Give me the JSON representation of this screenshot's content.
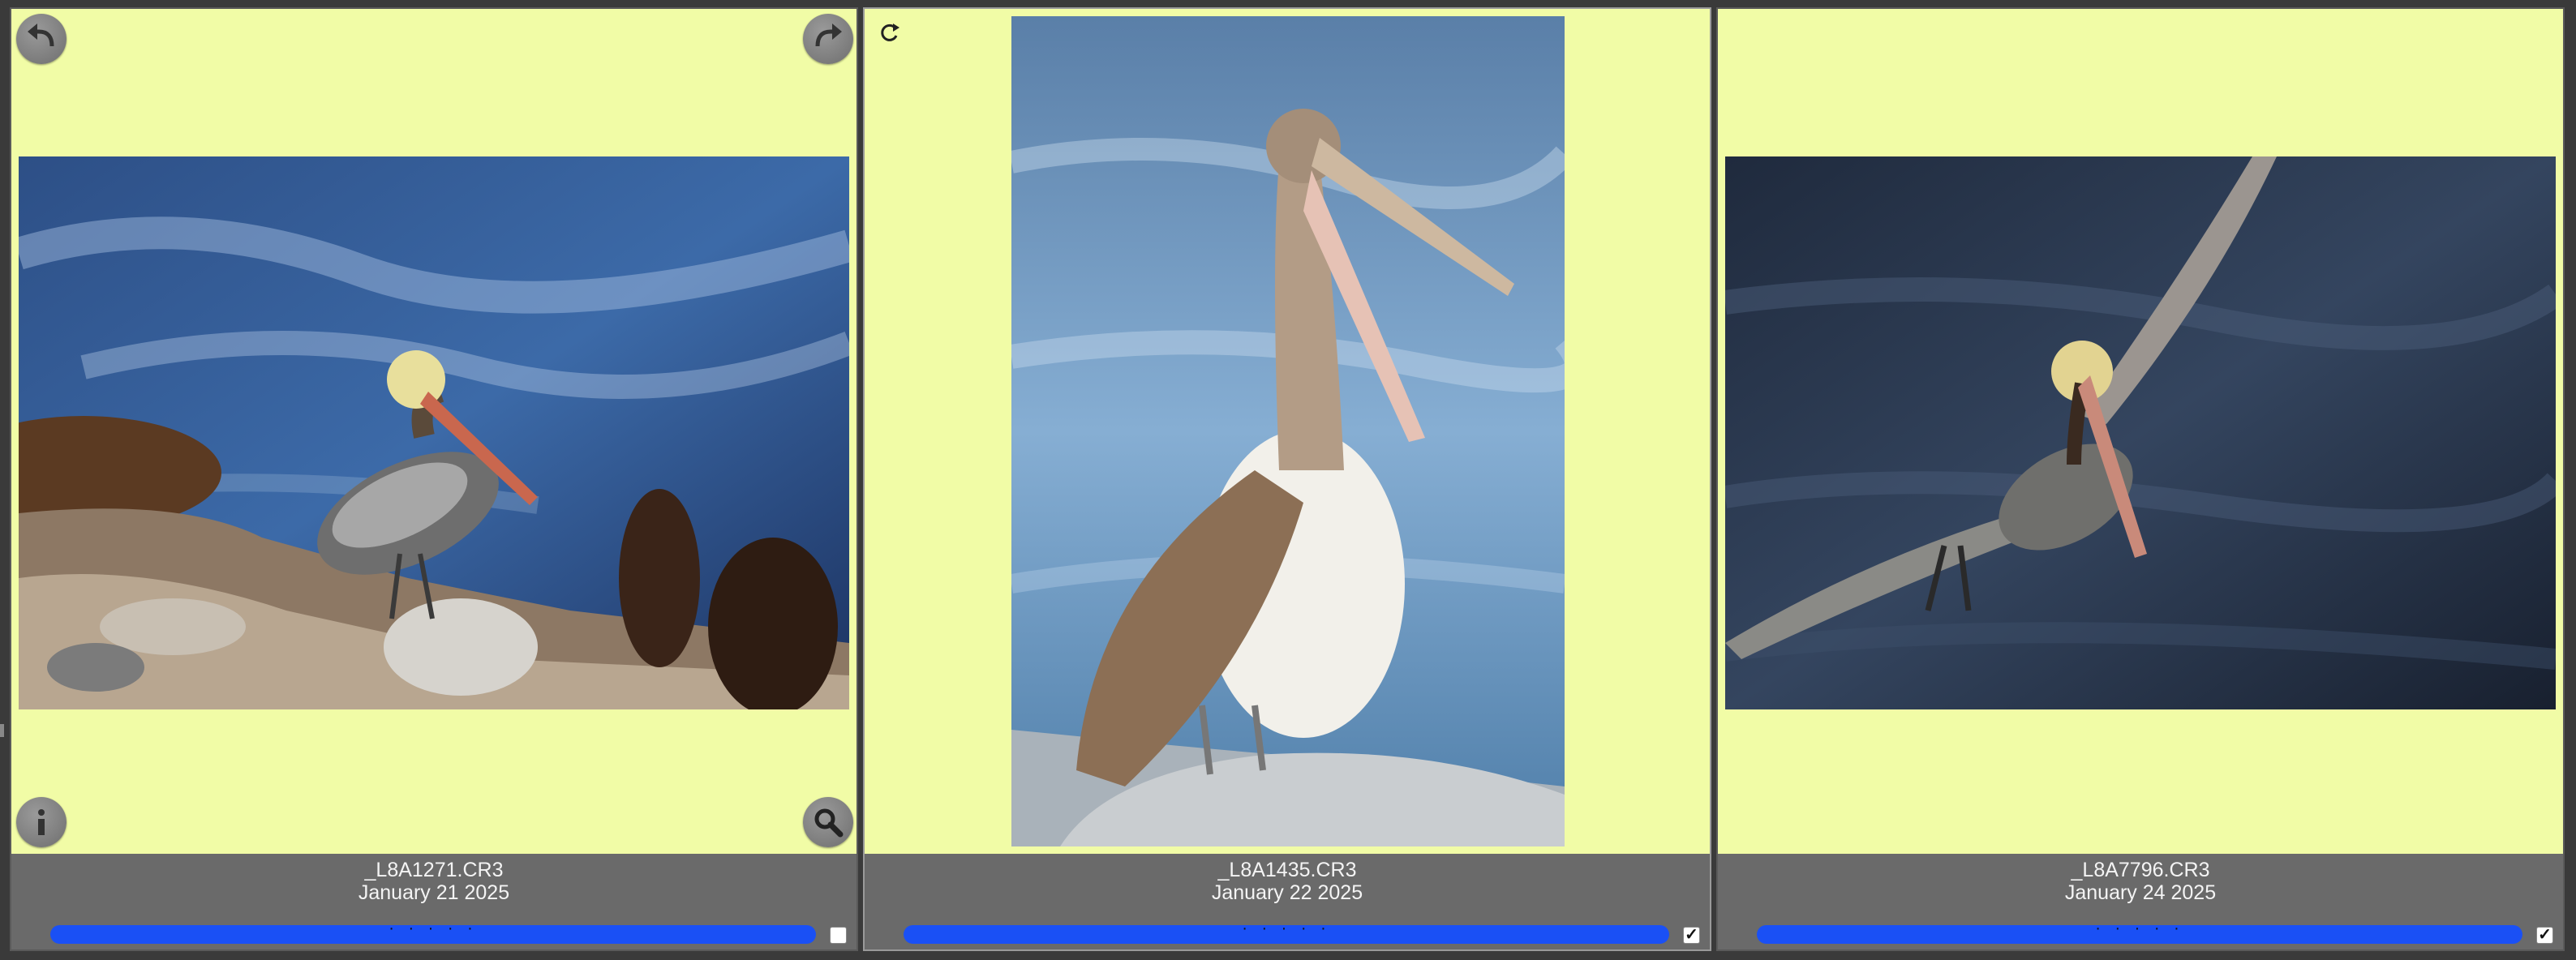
{
  "photos": [
    {
      "filename": "_L8A1271.CR3",
      "date": "January 21 2025",
      "rating_dots": "· · · · ·",
      "checked": false,
      "check_mark": ""
    },
    {
      "filename": "_L8A1435.CR3",
      "date": "January 22 2025",
      "rating_dots": "· · · · ·",
      "checked": true,
      "check_mark": "✓"
    },
    {
      "filename": "_L8A7796.CR3",
      "date": "January 24 2025",
      "rating_dots": "· · · · ·",
      "checked": true,
      "check_mark": "✓"
    }
  ],
  "icons": {
    "rotate_left": "rotate-left-icon",
    "rotate_right": "rotate-right-icon",
    "info": "info-icon",
    "zoom": "magnifier-icon",
    "sync": "sync-icon"
  },
  "colors": {
    "cell_background": "#f1fca6",
    "caption_background": "#6a6a6a",
    "rating_bar": "#1a50f5",
    "window_background": "#3a3a3a"
  }
}
